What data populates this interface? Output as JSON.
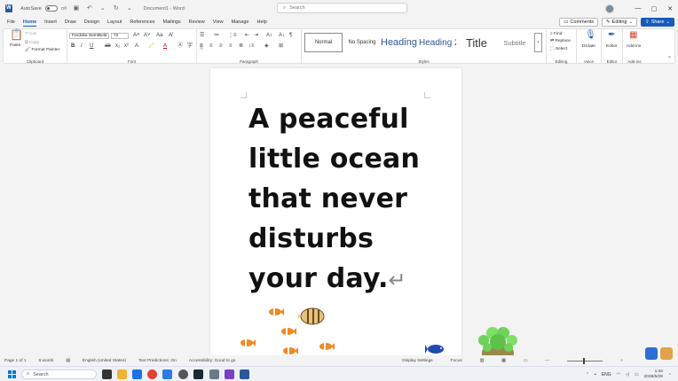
{
  "titlebar": {
    "autosave_label": "AutoSave",
    "autosave_state": "Off",
    "doc_title": "Document1 - Word",
    "search_placeholder": "Search"
  },
  "menu": {
    "tabs": [
      "File",
      "Home",
      "Insert",
      "Draw",
      "Design",
      "Layout",
      "References",
      "Mailings",
      "Review",
      "View",
      "Manage",
      "Help"
    ],
    "active": "Home",
    "comments": "Comments",
    "editing": "Editing",
    "share": "Share"
  },
  "ribbon": {
    "clipboard": {
      "label": "Clipboard",
      "paste": "Paste",
      "cut": "Cut",
      "copy": "Copy",
      "format_painter": "Format Painter"
    },
    "font": {
      "label": "Font",
      "family": "Fredoka SemiBold",
      "size": "72"
    },
    "paragraph": {
      "label": "Paragraph"
    },
    "styles": {
      "label": "Styles",
      "items": [
        "Normal",
        "No Spacing",
        "Heading 1",
        "Heading 2",
        "Title",
        "Subtitle"
      ]
    },
    "editing": {
      "label": "Editing",
      "find": "Find",
      "replace": "Replace",
      "select": "Select"
    },
    "voice": {
      "label": "Voice",
      "dictate": "Dictate"
    },
    "editor": {
      "label": "Editor",
      "editor": "Editor"
    },
    "addins": {
      "label": "Add-ins",
      "addins": "Add-ins"
    }
  },
  "document": {
    "lines": [
      "A peaceful",
      "little ocean",
      "that never",
      "disturbs",
      "your day."
    ]
  },
  "status": {
    "page": "Page 1 of 1",
    "words": "9 words",
    "language": "English (United States)",
    "text_predictions": "Text Predictions: On",
    "accessibility": "Accessibility: Good to go",
    "display_settings": "Display Settings",
    "focus": "Focus"
  },
  "taskbar": {
    "search": "Search",
    "lang": "ENG",
    "time": "1:44",
    "date": "2026/5/29"
  }
}
